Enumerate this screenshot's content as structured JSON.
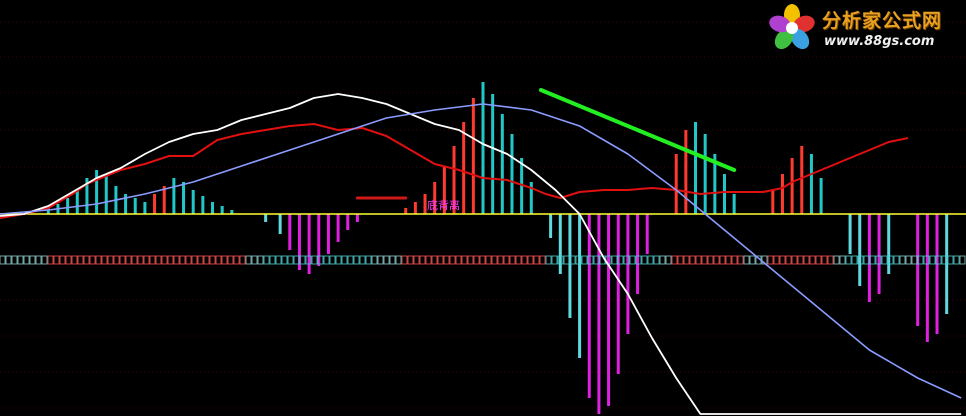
{
  "branding": {
    "name": "分析家公式网",
    "url": "www.88gs.com"
  },
  "annotations": {
    "divergence_label": "底背离"
  },
  "colors": {
    "background": "#000000",
    "gridline": "#7a0000",
    "zero_line": "#ffff33",
    "fast_line": "#ffffff",
    "slow_line": "#8a9cff",
    "upper_line": "#e01010",
    "bar_pos_red": "#ff3b30",
    "bar_pos_cyan": "#20c8c8",
    "bar_neg_magenta": "#e020e0",
    "bar_neg_cyan": "#5fd8e0",
    "divergence_line": "#22ee22",
    "divergence_short": "#d01818",
    "band_red": "#ff5555",
    "band_cyan": "#4fd0d0"
  },
  "chart_data": {
    "type": "line",
    "title": "",
    "xlabel": "",
    "ylabel": "",
    "x_count": 200,
    "ylim": [
      -100,
      100
    ],
    "grid": true,
    "series": [
      {
        "key": "upper",
        "points": [
          [
            0,
            -2
          ],
          [
            5,
            0
          ],
          [
            10,
            3
          ],
          [
            15,
            10
          ],
          [
            18,
            15
          ],
          [
            20,
            17
          ],
          [
            25,
            22
          ],
          [
            30,
            25
          ],
          [
            35,
            29
          ],
          [
            40,
            29
          ],
          [
            45,
            37
          ],
          [
            50,
            40
          ],
          [
            55,
            42
          ],
          [
            60,
            44
          ],
          [
            65,
            45
          ],
          [
            70,
            42
          ],
          [
            75,
            43
          ],
          [
            80,
            39
          ],
          [
            85,
            32
          ],
          [
            90,
            25
          ],
          [
            95,
            22
          ],
          [
            100,
            18
          ],
          [
            105,
            17
          ],
          [
            110,
            13
          ],
          [
            113,
            10
          ],
          [
            116,
            8
          ],
          [
            120,
            11
          ],
          [
            125,
            12
          ],
          [
            130,
            12
          ],
          [
            135,
            13
          ],
          [
            140,
            12
          ],
          [
            145,
            10
          ],
          [
            150,
            11
          ],
          [
            155,
            11
          ],
          [
            158,
            11
          ],
          [
            160,
            12
          ],
          [
            162,
            13
          ],
          [
            164,
            16
          ],
          [
            166,
            18
          ],
          [
            168,
            20
          ],
          [
            170,
            22
          ],
          [
            172,
            24
          ],
          [
            174,
            26
          ],
          [
            176,
            28
          ],
          [
            178,
            30
          ],
          [
            180,
            32
          ],
          [
            182,
            34
          ],
          [
            184,
            36
          ],
          [
            186,
            37
          ],
          [
            188,
            38
          ]
        ]
      },
      {
        "key": "fast",
        "points": [
          [
            0,
            -1
          ],
          [
            5,
            0
          ],
          [
            10,
            4
          ],
          [
            15,
            11
          ],
          [
            20,
            18
          ],
          [
            25,
            23
          ],
          [
            30,
            30
          ],
          [
            35,
            36
          ],
          [
            40,
            40
          ],
          [
            45,
            42
          ],
          [
            50,
            47
          ],
          [
            55,
            50
          ],
          [
            60,
            53
          ],
          [
            65,
            58
          ],
          [
            70,
            60
          ],
          [
            75,
            58
          ],
          [
            80,
            55
          ],
          [
            85,
            50
          ],
          [
            90,
            45
          ],
          [
            95,
            42
          ],
          [
            100,
            35
          ],
          [
            105,
            30
          ],
          [
            110,
            22
          ],
          [
            115,
            12
          ],
          [
            120,
            0
          ],
          [
            125,
            -22
          ],
          [
            130,
            -40
          ],
          [
            135,
            -62
          ],
          [
            140,
            -82
          ],
          [
            145,
            -100
          ],
          [
            150,
            -100
          ],
          [
            155,
            -100
          ],
          [
            160,
            -100
          ],
          [
            165,
            -100
          ],
          [
            170,
            -100
          ],
          [
            175,
            -100
          ],
          [
            180,
            -100
          ],
          [
            185,
            -100
          ],
          [
            190,
            -100
          ],
          [
            195,
            -100
          ],
          [
            199,
            -100
          ]
        ]
      },
      {
        "key": "slow",
        "points": [
          [
            0,
            0
          ],
          [
            10,
            2
          ],
          [
            20,
            5
          ],
          [
            30,
            10
          ],
          [
            40,
            16
          ],
          [
            50,
            24
          ],
          [
            60,
            32
          ],
          [
            70,
            40
          ],
          [
            80,
            48
          ],
          [
            90,
            52
          ],
          [
            100,
            55
          ],
          [
            110,
            52
          ],
          [
            120,
            44
          ],
          [
            130,
            30
          ],
          [
            140,
            12
          ],
          [
            150,
            -8
          ],
          [
            160,
            -28
          ],
          [
            170,
            -48
          ],
          [
            180,
            -68
          ],
          [
            190,
            -82
          ],
          [
            199,
            -92
          ]
        ]
      }
    ],
    "histogram": [
      {
        "x": 10,
        "value": 3,
        "color": "cyan"
      },
      {
        "x": 12,
        "value": 5,
        "color": "cyan"
      },
      {
        "x": 14,
        "value": 8,
        "color": "cyan"
      },
      {
        "x": 16,
        "value": 12,
        "color": "cyan"
      },
      {
        "x": 18,
        "value": 18,
        "color": "cyan"
      },
      {
        "x": 20,
        "value": 22,
        "color": "cyan"
      },
      {
        "x": 22,
        "value": 20,
        "color": "cyan"
      },
      {
        "x": 24,
        "value": 14,
        "color": "cyan"
      },
      {
        "x": 26,
        "value": 10,
        "color": "cyan"
      },
      {
        "x": 28,
        "value": 8,
        "color": "cyan"
      },
      {
        "x": 30,
        "value": 6,
        "color": "cyan"
      },
      {
        "x": 32,
        "value": 10,
        "color": "red"
      },
      {
        "x": 34,
        "value": 14,
        "color": "red"
      },
      {
        "x": 36,
        "value": 18,
        "color": "cyan"
      },
      {
        "x": 38,
        "value": 16,
        "color": "cyan"
      },
      {
        "x": 40,
        "value": 12,
        "color": "cyan"
      },
      {
        "x": 42,
        "value": 9,
        "color": "cyan"
      },
      {
        "x": 44,
        "value": 6,
        "color": "cyan"
      },
      {
        "x": 46,
        "value": 4,
        "color": "cyan"
      },
      {
        "x": 48,
        "value": 2,
        "color": "cyan"
      },
      {
        "x": 55,
        "value": -4,
        "color": "cyan"
      },
      {
        "x": 58,
        "value": -10,
        "color": "cyan"
      },
      {
        "x": 60,
        "value": -18,
        "color": "magenta"
      },
      {
        "x": 62,
        "value": -28,
        "color": "magenta"
      },
      {
        "x": 64,
        "value": -30,
        "color": "magenta"
      },
      {
        "x": 66,
        "value": -26,
        "color": "magenta"
      },
      {
        "x": 68,
        "value": -20,
        "color": "magenta"
      },
      {
        "x": 70,
        "value": -14,
        "color": "magenta"
      },
      {
        "x": 72,
        "value": -8,
        "color": "magenta"
      },
      {
        "x": 74,
        "value": -4,
        "color": "magenta"
      },
      {
        "x": 84,
        "value": 3,
        "color": "red"
      },
      {
        "x": 86,
        "value": 6,
        "color": "red"
      },
      {
        "x": 88,
        "value": 10,
        "color": "red"
      },
      {
        "x": 90,
        "value": 16,
        "color": "red"
      },
      {
        "x": 92,
        "value": 24,
        "color": "red"
      },
      {
        "x": 94,
        "value": 34,
        "color": "red"
      },
      {
        "x": 96,
        "value": 46,
        "color": "red"
      },
      {
        "x": 98,
        "value": 58,
        "color": "red"
      },
      {
        "x": 100,
        "value": 66,
        "color": "cyan"
      },
      {
        "x": 102,
        "value": 60,
        "color": "cyan"
      },
      {
        "x": 104,
        "value": 50,
        "color": "cyan"
      },
      {
        "x": 106,
        "value": 40,
        "color": "cyan"
      },
      {
        "x": 108,
        "value": 28,
        "color": "cyan"
      },
      {
        "x": 110,
        "value": 16,
        "color": "cyan"
      },
      {
        "x": 114,
        "value": -12,
        "color": "cyan"
      },
      {
        "x": 116,
        "value": -30,
        "color": "cyan"
      },
      {
        "x": 118,
        "value": -52,
        "color": "cyan"
      },
      {
        "x": 120,
        "value": -72,
        "color": "cyan"
      },
      {
        "x": 122,
        "value": -92,
        "color": "magenta"
      },
      {
        "x": 124,
        "value": -100,
        "color": "magenta"
      },
      {
        "x": 126,
        "value": -96,
        "color": "magenta"
      },
      {
        "x": 128,
        "value": -80,
        "color": "magenta"
      },
      {
        "x": 130,
        "value": -60,
        "color": "magenta"
      },
      {
        "x": 132,
        "value": -40,
        "color": "magenta"
      },
      {
        "x": 134,
        "value": -20,
        "color": "magenta"
      },
      {
        "x": 140,
        "value": 30,
        "color": "red"
      },
      {
        "x": 142,
        "value": 42,
        "color": "red"
      },
      {
        "x": 144,
        "value": 46,
        "color": "cyan"
      },
      {
        "x": 146,
        "value": 40,
        "color": "cyan"
      },
      {
        "x": 148,
        "value": 30,
        "color": "cyan"
      },
      {
        "x": 150,
        "value": 20,
        "color": "cyan"
      },
      {
        "x": 152,
        "value": 10,
        "color": "cyan"
      },
      {
        "x": 160,
        "value": 12,
        "color": "red"
      },
      {
        "x": 162,
        "value": 20,
        "color": "red"
      },
      {
        "x": 164,
        "value": 28,
        "color": "red"
      },
      {
        "x": 166,
        "value": 34,
        "color": "red"
      },
      {
        "x": 168,
        "value": 30,
        "color": "cyan"
      },
      {
        "x": 170,
        "value": 18,
        "color": "cyan"
      },
      {
        "x": 176,
        "value": -20,
        "color": "cyan"
      },
      {
        "x": 178,
        "value": -36,
        "color": "cyan"
      },
      {
        "x": 180,
        "value": -44,
        "color": "magenta"
      },
      {
        "x": 182,
        "value": -40,
        "color": "magenta"
      },
      {
        "x": 184,
        "value": -30,
        "color": "cyan"
      },
      {
        "x": 190,
        "value": -56,
        "color": "magenta"
      },
      {
        "x": 192,
        "value": -64,
        "color": "magenta"
      },
      {
        "x": 194,
        "value": -60,
        "color": "magenta"
      },
      {
        "x": 196,
        "value": -50,
        "color": "cyan"
      }
    ],
    "divergence": [
      {
        "from_x": 112,
        "from_y": 62,
        "to_x": 152,
        "to_y": 22,
        "color": "green"
      },
      {
        "from_x": 74,
        "from_y": 8,
        "to_x": 84,
        "to_y": 8,
        "color": "red"
      }
    ]
  }
}
